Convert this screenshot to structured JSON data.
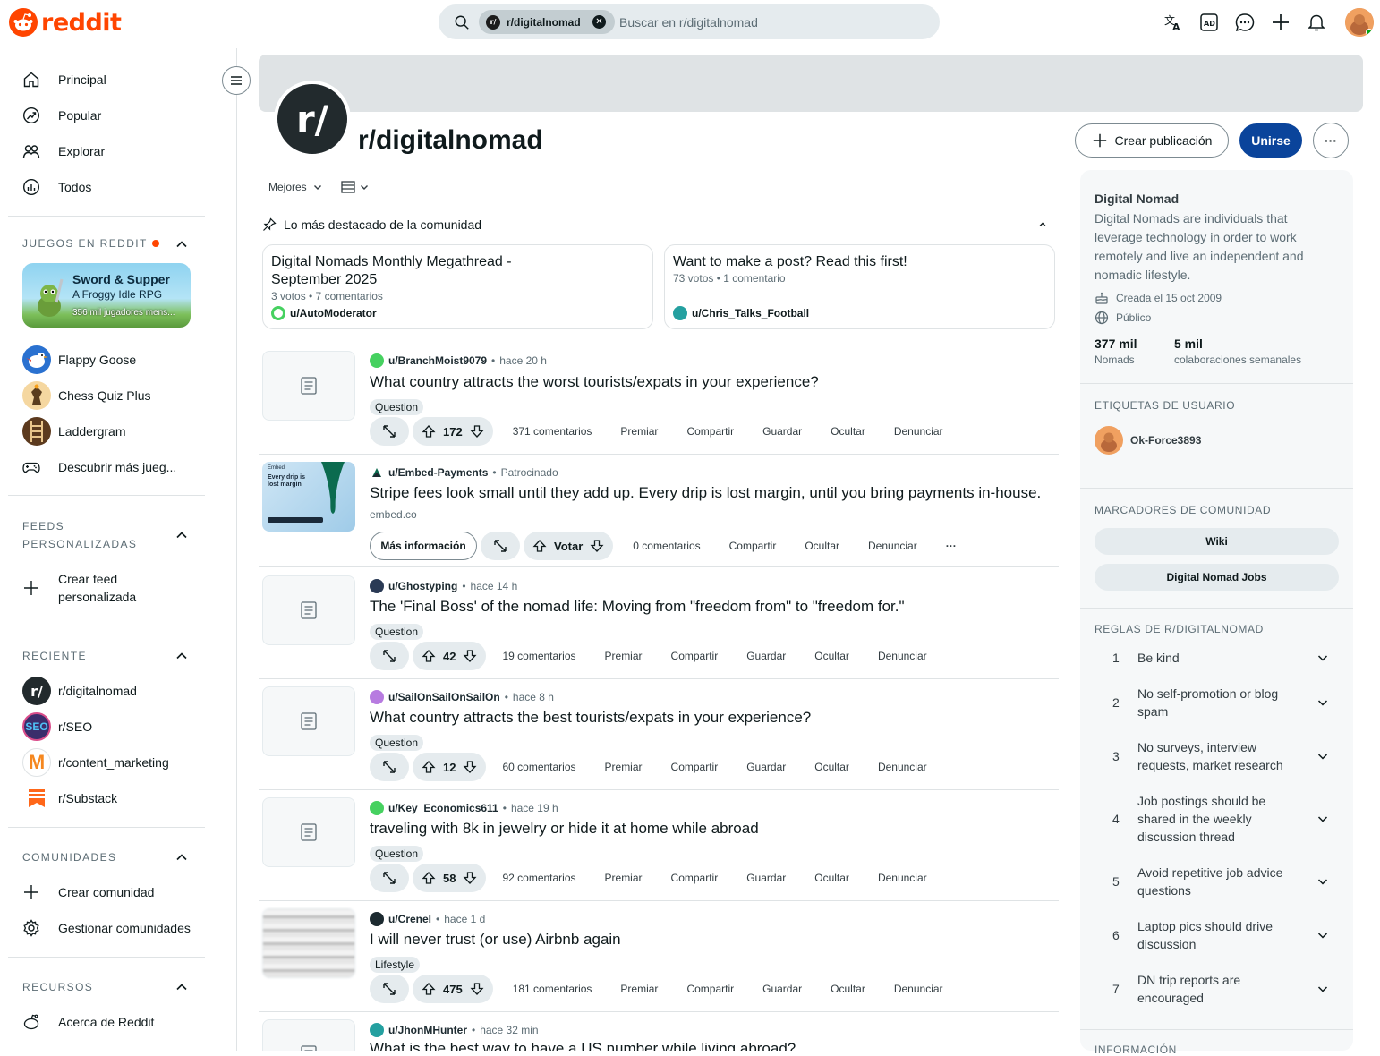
{
  "header": {
    "logo_text": "reddit",
    "search_chip": "r/digitalnomad",
    "search_placeholder": "Buscar en r/digitalnomad",
    "icons": [
      "translate-icon",
      "advertise-icon",
      "chat-icon",
      "create-icon",
      "notifications-icon",
      "avatar"
    ]
  },
  "sidebar": {
    "nav": [
      {
        "label": "Principal",
        "icon": "home-icon"
      },
      {
        "label": "Popular",
        "icon": "popular-icon"
      },
      {
        "label": "Explorar",
        "icon": "explore-icon"
      },
      {
        "label": "Todos",
        "icon": "all-icon"
      }
    ],
    "games_header": "JUEGOS EN REDDIT",
    "featured_game": {
      "title": "Sword & Supper",
      "subtitle": "A Froggy Idle RPG",
      "players": "356 mil jugadores mens..."
    },
    "games": [
      {
        "label": "Flappy Goose"
      },
      {
        "label": "Chess Quiz Plus"
      },
      {
        "label": "Laddergram"
      },
      {
        "label": "Descubrir más jueg..."
      }
    ],
    "feeds_header_1": "FEEDS",
    "feeds_header_2": "PERSONALIZADAS",
    "create_feed_1": "Crear feed",
    "create_feed_2": "personalizada",
    "recent_header": "RECIENTE",
    "recent": [
      {
        "label": "r/digitalnomad"
      },
      {
        "label": "r/SEO"
      },
      {
        "label": "r/content_marketing"
      },
      {
        "label": "r/Substack"
      }
    ],
    "communities_header": "COMUNIDADES",
    "create_community": "Crear comunidad",
    "manage_communities": "Gestionar comunidades",
    "resources_header": "RECURSOS",
    "about_reddit": "Acerca de Reddit"
  },
  "subreddit": {
    "name": "r/digitalnomad",
    "icon_text": "r/",
    "create_post": "Crear publicación",
    "join": "Unirse",
    "more": "···"
  },
  "feed": {
    "sort": "Mejores",
    "highlights_title": "Lo más destacado de la comunidad",
    "highlights": [
      {
        "title_1": "Digital Nomads Monthly Megathread -",
        "title_2": "September 2025",
        "meta": "3 votos • 7 comentarios",
        "user": "u/AutoModerator"
      },
      {
        "title_1": "Want to make a post? Read this first!",
        "title_2": "",
        "meta": "73 votos • 1 comentario",
        "user": "u/Chris_Talks_Football"
      }
    ],
    "posts": [
      {
        "user": "u/BranchMoist9079",
        "time": "hace 20 h",
        "title": "What country attracts the worst tourists/expats in your experience?",
        "flair": "Question",
        "votes": "172",
        "comments": "371 comentarios"
      },
      {
        "user": "u/Embed-Payments",
        "time": "Patrocinado",
        "title": "Stripe fees look small until they add up. Every drip is lost margin, until you bring payments in-house.",
        "domain": "embed.co",
        "cta": "Más información",
        "vote_label": "Votar",
        "comments": "0 comentarios",
        "ad_text_1": "Every drip is",
        "ad_text_2": "lost margin",
        "ad_brand": "Embed"
      },
      {
        "user": "u/Ghostyping",
        "time": "hace 14 h",
        "title": "The 'Final Boss' of the nomad life: Moving from \"freedom from\" to \"freedom for.\"",
        "flair": "Question",
        "votes": "42",
        "comments": "19 comentarios"
      },
      {
        "user": "u/SailOnSailOnSailOn",
        "time": "hace 8 h",
        "title": "What country attracts the best tourists/expats in your experience?",
        "flair": "Question",
        "votes": "12",
        "comments": "60 comentarios"
      },
      {
        "user": "u/Key_Economics611",
        "time": "hace 19 h",
        "title": "traveling with 8k in jewelry or hide it at home while abroad",
        "flair": "Question",
        "votes": "58",
        "comments": "92 comentarios"
      },
      {
        "user": "u/Crenel",
        "time": "hace 1 d",
        "title": "I will never trust (or use) Airbnb again",
        "flair": "Lifestyle",
        "votes": "475",
        "comments": "181 comentarios"
      },
      {
        "user": "u/JhonMHunter",
        "time": "hace 32 min",
        "title": "What is the best way to have a US number while living abroad?"
      }
    ],
    "actions": {
      "award": "Premiar",
      "share": "Compartir",
      "save": "Guardar",
      "hide": "Ocultar",
      "report": "Denunciar"
    },
    "dots": "···",
    "dot_sep": "•"
  },
  "about": {
    "title": "Digital Nomad",
    "desc_1": "Digital Nomads are individuals that",
    "desc_2": "leverage technology in order to work",
    "desc_3": "remotely and live an independent and",
    "desc_4": "nomadic lifestyle.",
    "created": "Creada el 15 oct 2009",
    "visibility": "Público",
    "members_value": "377 mil",
    "members_label": "Nomads",
    "weekly_value": "5 mil",
    "weekly_label": "colaboraciones semanales",
    "user_flair_header": "ETIQUETAS DE USUARIO",
    "user_flair_name": "Ok-Force3893",
    "bookmarks_header": "MARCADORES DE COMUNIDAD",
    "bookmarks": [
      "Wiki",
      "Digital Nomad Jobs"
    ],
    "rules_header": "REGLAS DE R/DIGITALNOMAD",
    "rules": [
      {
        "n": "1",
        "l1": "Be kind",
        "l2": "",
        "l3": ""
      },
      {
        "n": "2",
        "l1": "No self-promotion or blog",
        "l2": "spam",
        "l3": ""
      },
      {
        "n": "3",
        "l1": "No surveys, interview",
        "l2": "requests, market research",
        "l3": ""
      },
      {
        "n": "4",
        "l1": "Job postings should be",
        "l2": "shared in the weekly",
        "l3": "discussion thread"
      },
      {
        "n": "5",
        "l1": "Avoid repetitive job advice",
        "l2": "questions",
        "l3": ""
      },
      {
        "n": "6",
        "l1": "Laptop pics should drive",
        "l2": "discussion",
        "l3": ""
      },
      {
        "n": "7",
        "l1": "DN trip reports are",
        "l2": "encouraged",
        "l3": ""
      }
    ],
    "info_header": "INFORMACIÓN"
  },
  "colors": {
    "brand": "#ff4500",
    "join": "#0a449b",
    "muted": "#5c6c74",
    "border": "#dfe3e5"
  }
}
